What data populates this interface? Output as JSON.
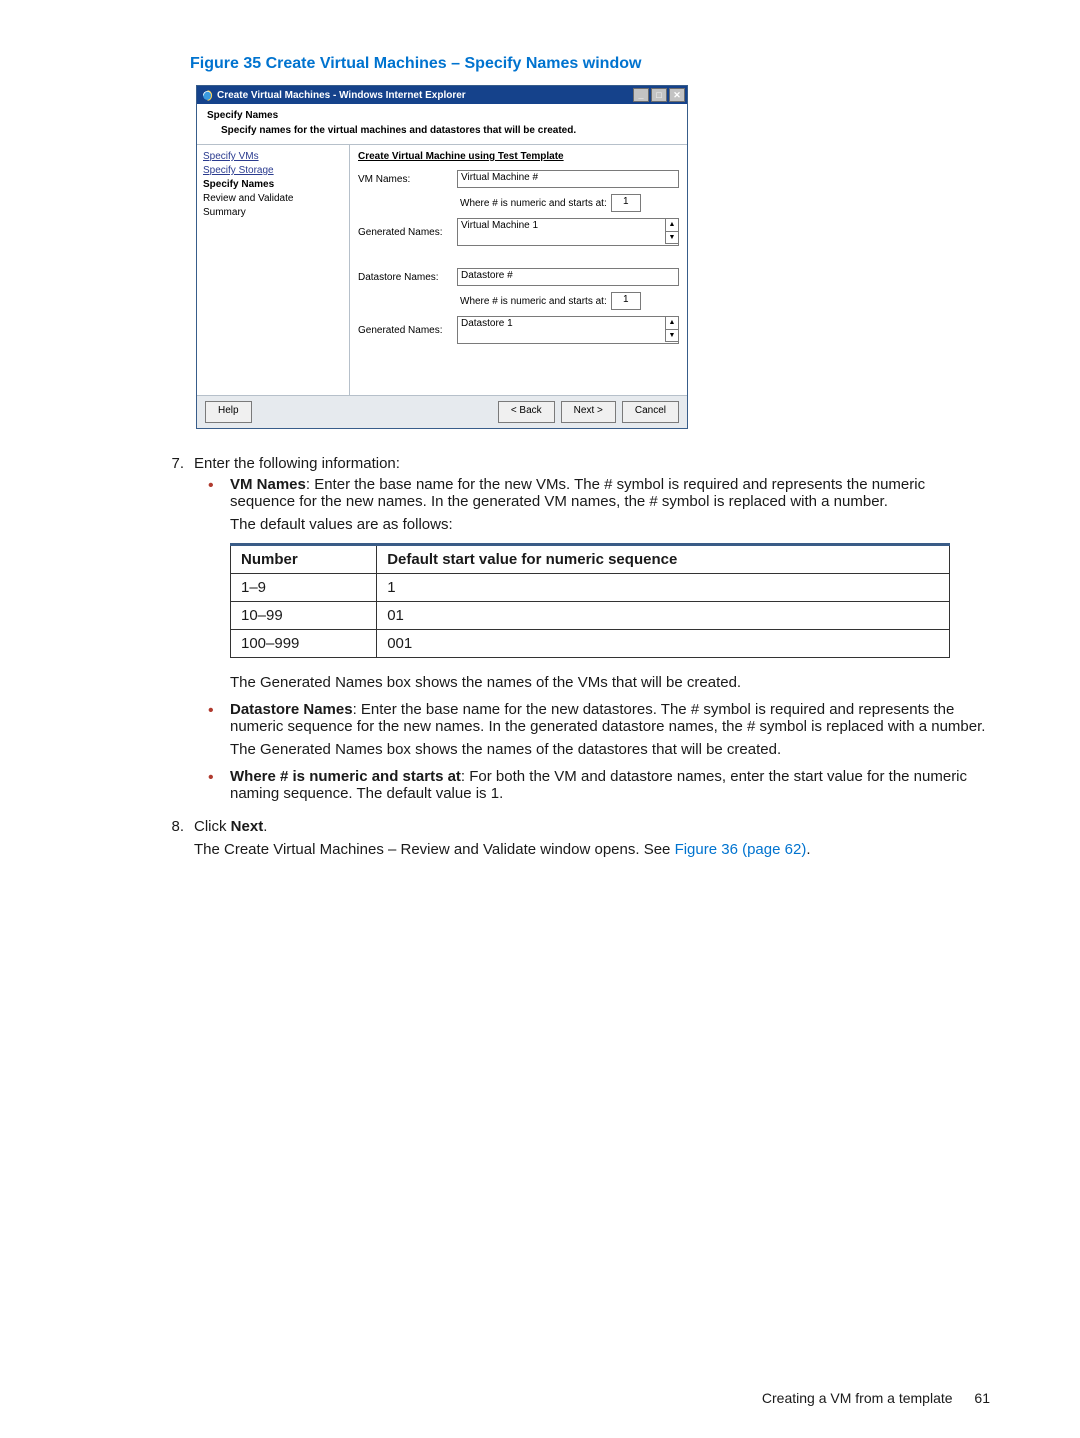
{
  "figure": {
    "caption_prefix": "Figure 35",
    "caption_rest": "Create Virtual Machines – Specify Names window",
    "window_title": "Create Virtual Machines - Windows Internet Explorer",
    "header_title": "Specify Names",
    "header_sub": "Specify names for the virtual machines and datastores that will be created.",
    "sidebar": {
      "s1": "Specify VMs",
      "s2": "Specify Storage",
      "s3": "Specify Names",
      "s4": "Review and Validate",
      "s5": "Summary"
    },
    "main": {
      "section_title": "Create Virtual Machine using Test Template",
      "vm_names_label": "VM Names:",
      "vm_names_value": "Virtual Machine #",
      "starts_text": "Where # is numeric and starts at:",
      "starts_value_vm": "1",
      "gen_label": "Generated Names:",
      "gen_vm_value": "Virtual Machine 1",
      "ds_names_label": "Datastore Names:",
      "ds_names_value": "Datastore #",
      "starts_value_ds": "1",
      "gen_ds_value": "Datastore 1"
    },
    "footer": {
      "help": "Help",
      "back": "< Back",
      "next": "Next >",
      "cancel": "Cancel"
    }
  },
  "steps": {
    "n7": "7.",
    "n7_text": "Enter the following information:",
    "b1_bold": "VM Names",
    "b1_text": ": Enter the base name for the new VMs. The # symbol is required and represents the numeric sequence for the new names. In the generated VM names, the # symbol is replaced with a number.",
    "b1_p2": "The default values are as follows:",
    "table": {
      "h1": "Number",
      "h2": "Default start value for numeric sequence",
      "r1c1": "1–9",
      "r1c2": "1",
      "r2c1": "10–99",
      "r2c2": "01",
      "r3c1": "100–999",
      "r3c2": "001"
    },
    "b1_p3": "The Generated Names box shows the names of the VMs that will be created.",
    "b2_bold": "Datastore Names",
    "b2_text": ": Enter the base name for the new datastores. The # symbol is required and represents the numeric sequence for the new names. In the generated datastore names, the # symbol is replaced with a number.",
    "b2_p2": "The Generated Names box shows the names of the datastores that will be created.",
    "b3_bold": "Where # is numeric and starts at",
    "b3_text": ": For both the VM and datastore names, enter the start value for the numeric naming sequence. The default value is 1.",
    "n8": "8.",
    "n8_pre": "Click ",
    "n8_bold": "Next",
    "n8_post": ".",
    "n8_p2_pre": "The Create Virtual Machines – Review and Validate window opens. See ",
    "n8_link": "Figure 36 (page 62)",
    "n8_p2_post": "."
  },
  "footer": {
    "text": "Creating a VM from a template",
    "page": "61"
  }
}
